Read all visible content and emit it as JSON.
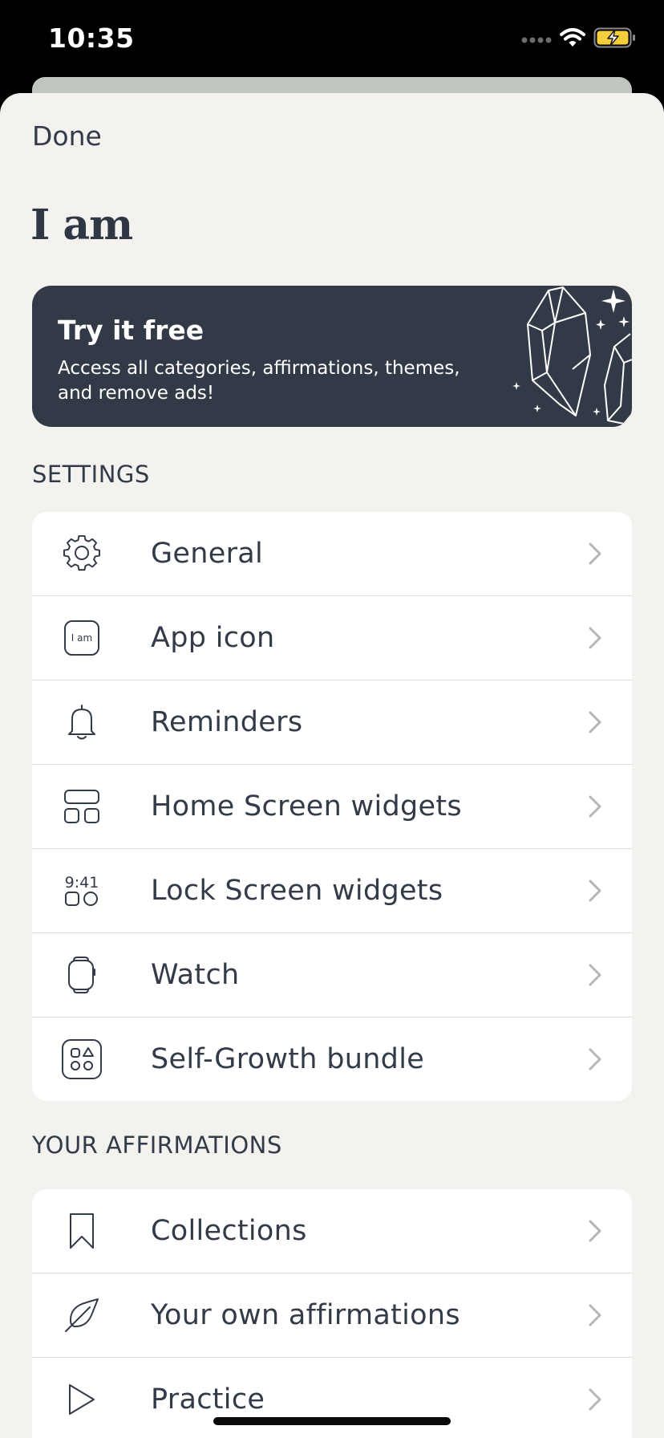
{
  "status_bar": {
    "time": "10:35"
  },
  "header": {
    "done_label": "Done",
    "title": "I am"
  },
  "promo": {
    "title": "Try it free",
    "subtitle": "Access all categories, affirmations, themes, and remove ads!"
  },
  "settings": {
    "section_label": "SETTINGS",
    "items": [
      {
        "label": "General",
        "icon": "gear-icon"
      },
      {
        "label": "App icon",
        "icon": "app-icon-icon",
        "icon_text": "I am"
      },
      {
        "label": "Reminders",
        "icon": "bell-icon"
      },
      {
        "label": "Home Screen widgets",
        "icon": "home-widgets-icon"
      },
      {
        "label": "Lock Screen widgets",
        "icon": "lock-widgets-icon",
        "icon_text": "9:41"
      },
      {
        "label": "Watch",
        "icon": "watch-icon"
      },
      {
        "label": "Self-Growth bundle",
        "icon": "bundle-icon"
      }
    ]
  },
  "affirmations": {
    "section_label": "YOUR AFFIRMATIONS",
    "items": [
      {
        "label": "Collections",
        "icon": "bookmark-icon"
      },
      {
        "label": "Your own affirmations",
        "icon": "leaf-icon"
      },
      {
        "label": "Practice",
        "icon": "play-icon"
      }
    ]
  },
  "colors": {
    "sheet_bg": "#f3f2ef",
    "promo_bg": "#323a47",
    "text": "#333a48",
    "battery": "#f5cf3b"
  }
}
